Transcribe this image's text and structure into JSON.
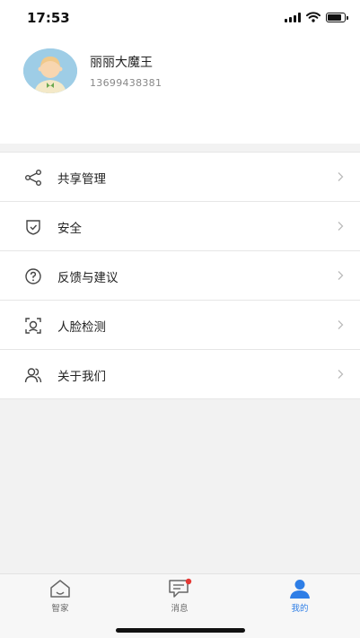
{
  "status_bar": {
    "time": "17:53",
    "battery_level": 0.9
  },
  "profile": {
    "name": "丽丽大魔王",
    "phone": "13699438381",
    "avatar_icon": "avatar-icon"
  },
  "menu": [
    {
      "label": "共享管理",
      "icon": "share-icon"
    },
    {
      "label": "安全",
      "icon": "shield-check-icon"
    },
    {
      "label": "反馈与建议",
      "icon": "help-circle-icon"
    },
    {
      "label": "人脸检测",
      "icon": "face-scan-icon"
    },
    {
      "label": "关于我们",
      "icon": "users-icon"
    }
  ],
  "tabs": [
    {
      "label": "智家",
      "icon": "home-icon",
      "active": false
    },
    {
      "label": "消息",
      "icon": "message-icon",
      "active": false,
      "badge": true
    },
    {
      "label": "我的",
      "icon": "user-icon",
      "active": true
    }
  ],
  "colors": {
    "accent": "#2e7ee6",
    "badge": "#e53935",
    "background": "#f2f2f2"
  }
}
